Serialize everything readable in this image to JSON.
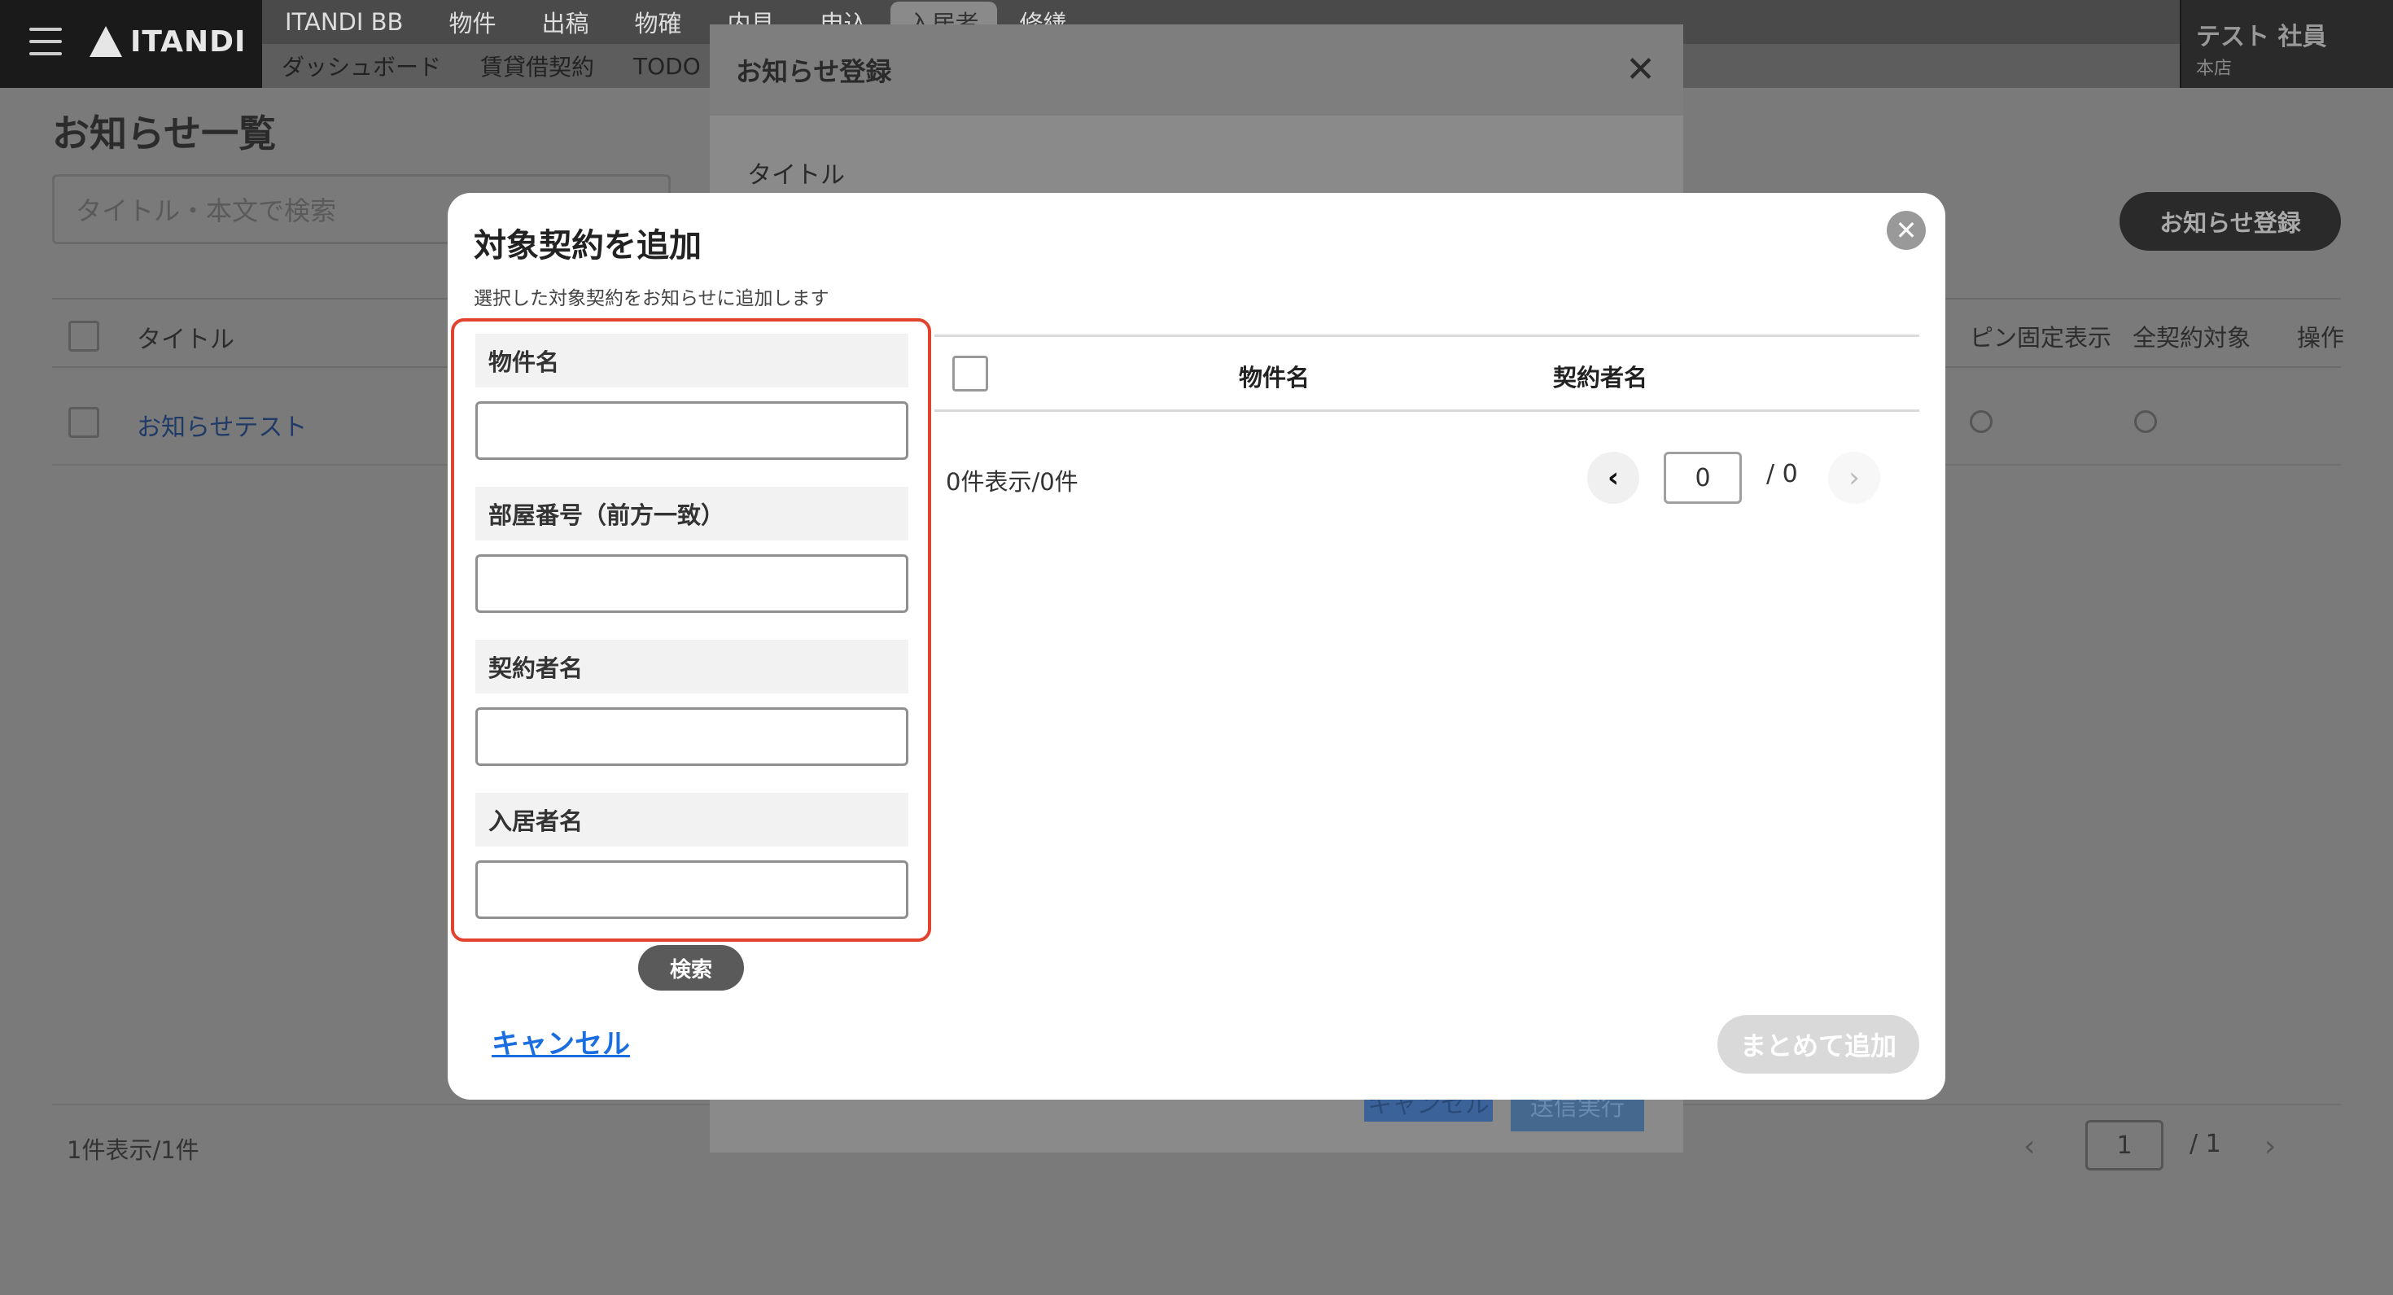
{
  "app": {
    "logo_text": "ITANDI",
    "nav_row1": [
      "ITANDI BB",
      "物件",
      "出稿",
      "物確",
      "内見",
      "申込",
      "入居者",
      "修繕"
    ],
    "nav_row1_active": "入居者",
    "nav_row2": [
      "ダッシュボード",
      "賃貸借契約",
      "TODO"
    ],
    "user_name": "テスト 社員",
    "user_branch": "本店"
  },
  "page": {
    "title": "お知らせ一覧",
    "search_placeholder": "タイトル・本文で検索",
    "register_button": "お知らせ登録",
    "columns": {
      "title": "タイトル",
      "pin": "ピン固定表示",
      "all_contracts": "全契約対象",
      "actions": "操作"
    },
    "rows": [
      {
        "title": "お知らせテスト"
      }
    ],
    "footer_count": "1件表示/1件",
    "pagination": {
      "current": "1",
      "total": "/ 1",
      "prev": "‹",
      "next": "›"
    }
  },
  "modal_register": {
    "title": "お知らせ登録",
    "close": "✕",
    "field_title_label": "タイトル",
    "cancel": "キャンセル",
    "submit": "送信実行"
  },
  "modal_add_contract": {
    "title": "対象契約を追加",
    "subtitle": "選択した対象契約をお知らせに追加します",
    "close": "✕",
    "fields": [
      {
        "label": "物件名",
        "value": ""
      },
      {
        "label": "部屋番号（前方一致）",
        "value": ""
      },
      {
        "label": "契約者名",
        "value": ""
      },
      {
        "label": "入居者名",
        "value": ""
      }
    ],
    "search_button": "検索",
    "results": {
      "columns": [
        "物件名",
        "契約者名"
      ],
      "count": "0件表示/0件",
      "prev": "‹",
      "page": "0",
      "total": "/ 0",
      "next": "›"
    },
    "cancel": "キャンセル",
    "add_all_button": "まとめて追加"
  },
  "colors": {
    "highlight_border": "#e2422e",
    "link_blue": "#1a6ee0",
    "disabled_button": "#d9d9d9"
  }
}
